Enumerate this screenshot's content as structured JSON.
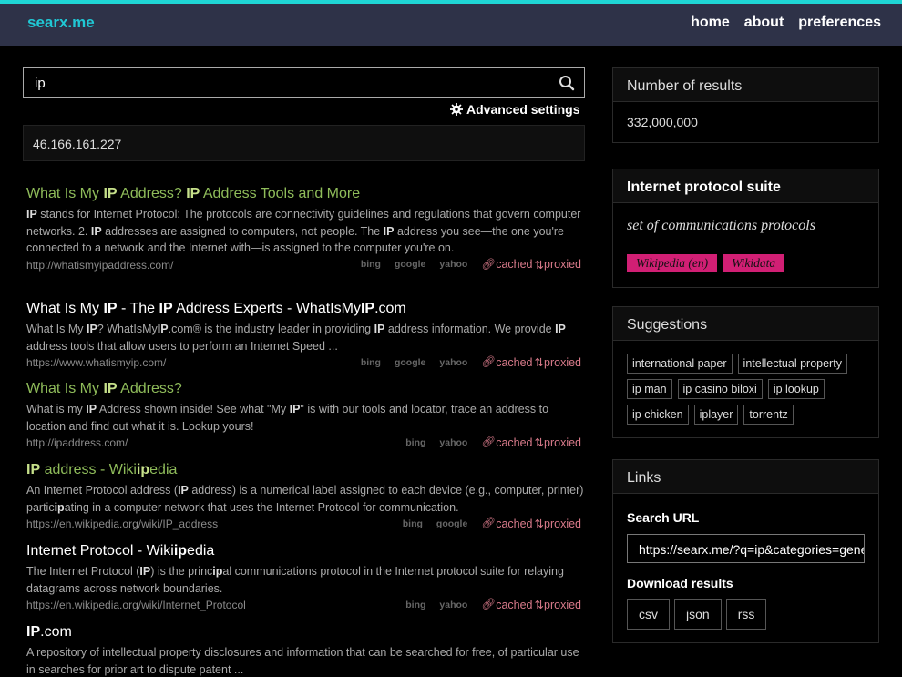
{
  "header": {
    "brand": "searx.me",
    "nav": [
      "home",
      "about",
      "preferences"
    ]
  },
  "search": {
    "query": "ip",
    "advanced_label": "Advanced settings"
  },
  "answer": "46.166.161.227",
  "results": [
    {
      "title_html": "What Is My <b>IP</b> Address? <b>IP</b> Address Tools and More",
      "snippet_html": "<b class='hl'>IP</b> stands for Internet Protocol: The protocols are connectivity guidelines and regulations that govern computer networks. 2. <b class='hl'>IP</b> addresses are assigned to computers, not people. The <b class='hl'>IP</b> address you see—the one you're connected to a network and the Internet with—is assigned to the computer you're on.",
      "url": "http://whatismyipaddress.com/",
      "engines": [
        "bing",
        "google",
        "yahoo"
      ],
      "cached": "cached",
      "proxied": "proxied"
    },
    {
      "title_html": "What Is My <b>IP</b> - The <b>IP</b> Address Experts - WhatIsMy<b>IP</b>.com",
      "snippet_html": "What Is My <b class='hl'>IP</b>? WhatIsMy<b class='hl'>IP</b>.com® is the industry leader in providing <b class='hl'>IP</b> address information. We provide <b class='hl'>IP</b> address tools that allow users to perform an Internet Speed ...",
      "url": "https://www.whatismyip.com/",
      "engines": [
        "bing",
        "google",
        "yahoo"
      ],
      "cached": "cached",
      "proxied": "proxied"
    },
    {
      "title_html": "What Is My <b>IP</b> Address?",
      "snippet_html": "What is my <b class='hl'>IP</b> Address shown inside! See what \"My <b class='hl'>IP</b>\" is with our tools and locator, trace an address to location and find out what it is. Lookup yours!",
      "url": "http://ipaddress.com/",
      "engines": [
        "bing",
        "yahoo"
      ],
      "cached": "cached",
      "proxied": "proxied"
    },
    {
      "title_html": "<b>IP</b> address - Wiki<b>ip</b>edia",
      "snippet_html": "An Internet Protocol address (<b class='hl'>IP</b> address) is a numerical label assigned to each device (e.g., computer, printer) partic<b class='hl'>ip</b>ating in a computer network that uses the Internet Protocol for communication.",
      "url": "https://en.wikipedia.org/wiki/IP_address",
      "engines": [
        "bing",
        "google"
      ],
      "cached": "cached",
      "proxied": "proxied"
    },
    {
      "title_html": "Internet Protocol - Wiki<b>ip</b>edia",
      "snippet_html": "The Internet Protocol (<b class='hl'>IP</b>) is the princ<b class='hl'>ip</b>al communications protocol in the Internet protocol suite for relaying datagrams across network boundaries.",
      "url": "https://en.wikipedia.org/wiki/Internet_Protocol",
      "engines": [
        "bing",
        "yahoo"
      ],
      "cached": "cached",
      "proxied": "proxied"
    },
    {
      "title_html": "<b>IP</b>.com",
      "snippet_html": "A repository of intellectual property disclosures and information that can be searched for free, of particular use in searches for prior art to dispute patent ...",
      "url": "",
      "engines": [],
      "cached": "",
      "proxied": ""
    }
  ],
  "sidebar": {
    "results_heading": "Number of results",
    "results_count": "332,000,000",
    "infobox": {
      "title": "Internet protocol suite",
      "description": "set of communications protocols",
      "links": [
        "Wikipedia (en)",
        "Wikidata"
      ]
    },
    "suggestions_heading": "Suggestions",
    "suggestions": [
      "international paper",
      "intellectual property",
      "ip man",
      "ip casino biloxi",
      "ip lookup",
      "ip chicken",
      "iplayer",
      "torrentz"
    ],
    "links_heading": "Links",
    "search_url_label": "Search URL",
    "search_url": "https://searx.me/?q=ip&categories=general",
    "download_label": "Download results",
    "download_formats": [
      "csv",
      "json",
      "rss"
    ]
  },
  "colors": {
    "accent": "#1fd5d5",
    "header_bg": "#2e3248",
    "link_green": "#8fbc5a",
    "tag_pink": "#d11f74",
    "proxy_link": "#d87a8a"
  }
}
